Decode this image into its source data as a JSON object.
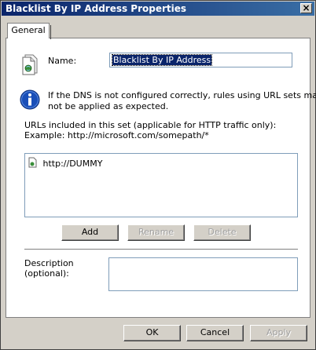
{
  "window": {
    "title": "Blacklist By IP Address Properties",
    "close_glyph": "×"
  },
  "tabs": [
    {
      "label": "General"
    }
  ],
  "name_field": {
    "label": "Name:",
    "value": "Blacklist By IP Address"
  },
  "info": {
    "text_line1": "If the DNS is not configured correctly, rules using URL sets may",
    "text_line2": "not be applied as expected."
  },
  "urls": {
    "intro_line1": "URLs included in this set (applicable for HTTP traffic only):",
    "intro_line2": "Example: http://microsoft.com/somepath/*",
    "items": [
      "http://DUMMY"
    ]
  },
  "list_buttons": {
    "add": "Add",
    "rename": "Rename",
    "delete": "Delete"
  },
  "description": {
    "label_line1": "Description",
    "label_line2": "(optional):",
    "value": ""
  },
  "dialog_buttons": {
    "ok": "OK",
    "cancel": "Cancel",
    "apply": "Apply"
  }
}
